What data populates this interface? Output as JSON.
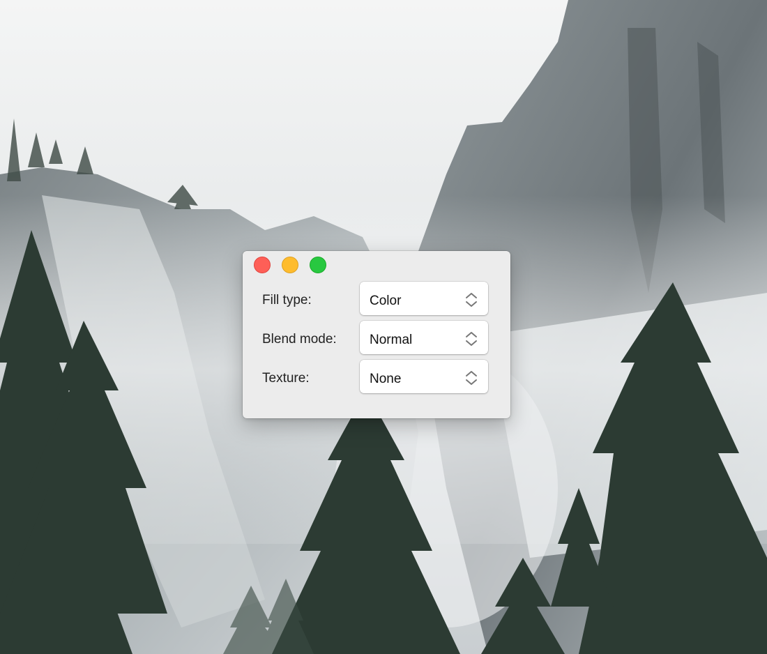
{
  "window": {
    "controls": {
      "close": "close-icon",
      "minimize": "minimize-icon",
      "zoom": "zoom-icon"
    },
    "fields": [
      {
        "label": "Fill type:",
        "value": "Color"
      },
      {
        "label": "Blend mode:",
        "value": "Normal"
      },
      {
        "label": "Texture:",
        "value": "None"
      }
    ],
    "stepper_icon": "up-down-chevron-icon"
  },
  "colors": {
    "close": "#fe5f57",
    "minimize": "#febc2e",
    "zoom": "#28c840",
    "window_bg": "#ececec"
  }
}
